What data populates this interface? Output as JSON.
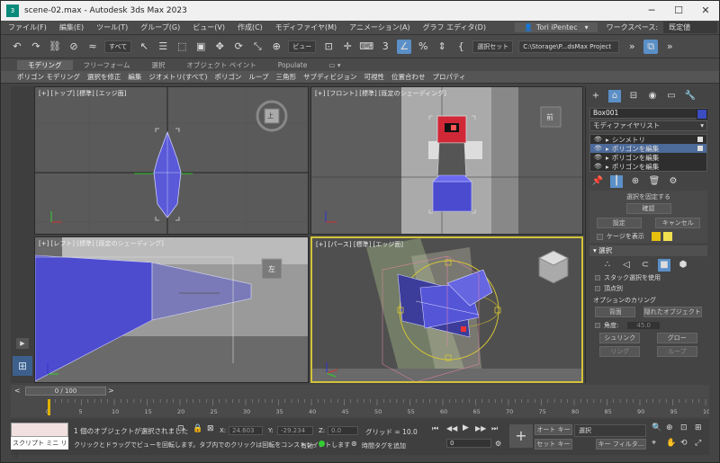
{
  "window": {
    "title": "scene-02.max - Autodesk 3ds Max 2023",
    "app_icon": "3",
    "caps": [
      "─",
      "☐",
      "✕"
    ]
  },
  "menu": {
    "items": [
      "ファイル(F)",
      "編集(E)",
      "ツール(T)",
      "グループ(G)",
      "ビュー(V)",
      "作成(C)",
      "モディファイヤ(M)",
      "アニメーション(A)",
      "グラフ エディタ(D)"
    ],
    "user": "Tori iPentec",
    "workspace_label": "ワークスペース:",
    "workspace_value": "既定値"
  },
  "toolbar": {
    "selection_filter": "すべて",
    "view_dropdown": "ビュー",
    "selection_set": "選択セット",
    "project_path": "C:\\Storage\\P...dsMax Project"
  },
  "ribbon": {
    "tabs": [
      "モデリング",
      "フリーフォーム",
      "選択",
      "オブジェクト ペイント",
      "Populate"
    ],
    "active_tab": 0,
    "commands": [
      "ポリゴン モデリング",
      "選択を修正",
      "編集",
      "ジオメトリ(すべて)",
      "ポリゴン",
      "ループ",
      "三角形",
      "サブディビジョン",
      "可視性",
      "位置合わせ",
      "プロパティ"
    ]
  },
  "viewports": {
    "top": "[+] [トップ] [標準] [エッジ面]",
    "front": "[+] [フロント] [標準] [既定のシェーディング]",
    "left": "[+] [レフト] [標準] [既定のシェーディング]",
    "persp": "[+] [パース] [標準] [エッジ面]",
    "cube_labels": {
      "top": "上",
      "front": "前",
      "left": "左"
    }
  },
  "command_panel": {
    "object_name": "Box001",
    "object_color": "#3b4cc0",
    "modifier_list": "モディファイヤリスト",
    "stack": [
      "シンメトリ",
      "ポリゴンを編集",
      "ポリゴンを編集",
      "ポリゴンを編集"
    ],
    "selected_stack_index": 1,
    "partial_title": "選択を固定する",
    "stack_buttons": [
      "確認",
      "設定",
      "キャンセル"
    ],
    "cage_label": "ケージを表示",
    "selection_rollout": "選択",
    "by_vertex": "スタック選択を使用",
    "by_angle_check": "頂点別",
    "options_label": "オプションのカリング",
    "back_face": "背面",
    "hidden_obj": "隠れたオブジェクト",
    "angle_label": "角度:",
    "angle_value": "45.0",
    "shrink": "シュリンク",
    "grow": "グロー",
    "ring": "リング",
    "loop": "ループ"
  },
  "timeline": {
    "thumb": "0 / 100",
    "ticks": [
      "0",
      "5",
      "10",
      "15",
      "20",
      "25",
      "30",
      "35",
      "40",
      "45",
      "50",
      "55",
      "60",
      "65",
      "70",
      "75",
      "80",
      "85",
      "90",
      "95",
      "100"
    ],
    "current_frame": 0
  },
  "status": {
    "script_label": "スクリプト ミニ リス",
    "message1": "1 個のオブジェクトが選択されました",
    "message2": "クリックとドラッグでビューを回転します。タブ内でのクリックは回転をコンストレイントします",
    "x_label": "X:",
    "x_value": "24.603",
    "y_label": "Y:",
    "y_value": "-29.234",
    "z_label": "Z:",
    "z_value": "0.0",
    "grid": "グリッド = 10.0",
    "enabled_label": "有効:",
    "add_time_tag": "時間タグを追加",
    "auto_key": "オート キー",
    "set_key": "セット キー",
    "key_select": "選択",
    "key_filter": "キー フィルタ...",
    "frame_value": "0"
  }
}
